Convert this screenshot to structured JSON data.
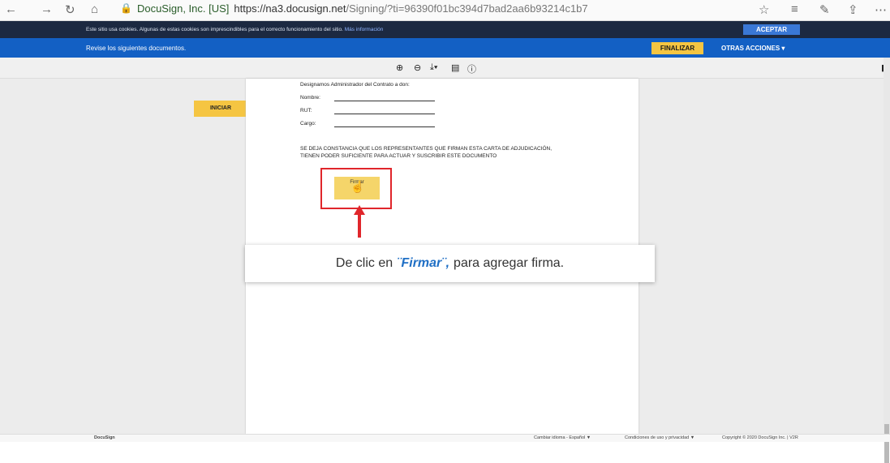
{
  "browser": {
    "site_identity": "DocuSign, Inc. [US]",
    "url_host": "https://na3.docusign.net",
    "url_path": "/Signing/?ti=96390f01bc394d7bad2aa6b93214c1b7"
  },
  "cookie_bar": {
    "text": "Este sitio usa cookies. Algunas de estas cookies son imprescindibles para el correcto funcionamiento del sitio.",
    "more_link": "Más información",
    "accept_label": "ACEPTAR"
  },
  "action_bar": {
    "instruction": "Revise los siguientes documentos.",
    "finish_label": "FINALIZAR",
    "other_actions_label": "OTRAS ACCIONES ▾"
  },
  "toolbar": {
    "icons": [
      "zoom-in-icon",
      "zoom-out-icon",
      "download-icon",
      "print-icon",
      "help-icon"
    ]
  },
  "start_tab_label": "INICIAR",
  "document": {
    "heading": "Designamos Administrador del Contrato a don:",
    "fields": [
      "Nombre:",
      "RUT:",
      "Cargo:"
    ],
    "statement_line1": "SE DEJA CONSTANCIA QUE LOS REPRESENTANTES QUE FIRMAN ESTA CARTA DE ADJUDICACIÓN,",
    "statement_line2": "TIENEN PODER SUFICIENTE PARA ACTUAR Y SUSCRIBIR ESTE DOCUMENTO",
    "sign_tab_label": "Firmar"
  },
  "callout": {
    "prefix": "De clic en",
    "emphasis": "¨Firmar¨,",
    "suffix": "para agregar firma."
  },
  "footer": {
    "brand": "DocuSign",
    "language": "Cambiar idioma - Español ▼",
    "terms": "Condiciones de uso y privacidad ▼",
    "copyright": "Copyright © 2020 DocuSign Inc. | V2R"
  },
  "colors": {
    "accent_yellow": "#f5c542",
    "header_blue": "#1360c4",
    "highlight_red": "#e0262b"
  }
}
